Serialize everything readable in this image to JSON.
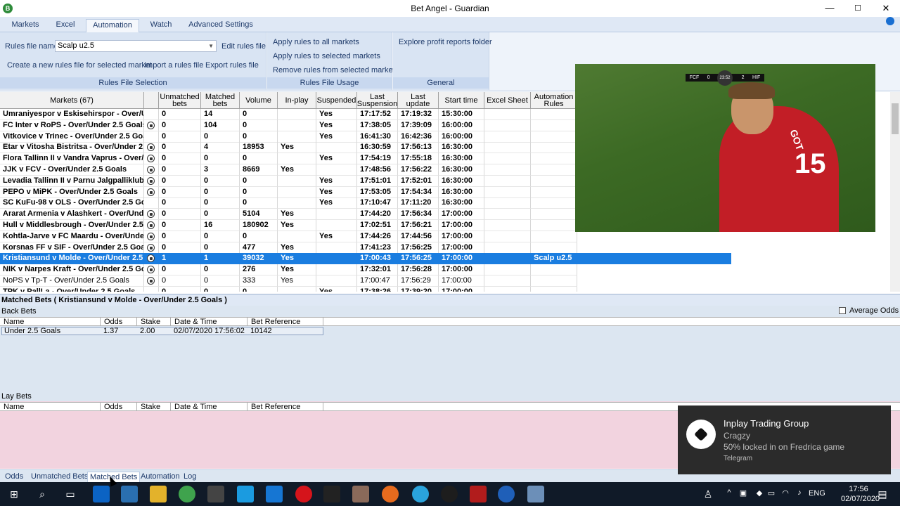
{
  "window": {
    "title": "Bet Angel - Guardian",
    "icon": "bet-angel-logo-icon",
    "minimize": "—",
    "maximize": "☐",
    "close": "✕"
  },
  "ribbon": {
    "tabs": [
      "Markets",
      "Excel",
      "Automation",
      "Watch",
      "Advanced Settings"
    ],
    "active_tab": "Automation",
    "rules_file": {
      "label": "Rules file name",
      "value": "Scalp u2.5",
      "edit": "Edit rules file",
      "create": "Create a new rules file for selected market",
      "import": "Import a rules file",
      "export": "Export rules file",
      "group_label": "Rules File Selection"
    },
    "usage": {
      "apply_all": "Apply rules to all markets",
      "apply_selected": "Apply rules to selected markets",
      "remove": "Remove rules from selected markets",
      "group_label": "Rules File Usage"
    },
    "general": {
      "explore": "Explore profit reports folder",
      "group_label": "General"
    }
  },
  "grid": {
    "headers": [
      "Markets (67)",
      "",
      "Unmatched bets",
      "Matched bets",
      "Volume",
      "In-play",
      "Suspended",
      "Last Suspension",
      "Last update",
      "Start time",
      "Excel Sheet",
      "Automation Rules"
    ],
    "rows": [
      {
        "name": "Umraniyespor v Eskisehirspor - Over/Under 2",
        "ball": false,
        "unmatched": "0",
        "matched": "14",
        "volume": "0",
        "inplay": "",
        "suspended": "Yes",
        "last_susp": "17:17:52",
        "last_update": "17:19:32",
        "start": "15:30:00",
        "excel": "",
        "rules": "",
        "bold": true
      },
      {
        "name": "FC Inter v RoPS - Over/Under 2.5 Goals",
        "ball": true,
        "unmatched": "0",
        "matched": "104",
        "volume": "0",
        "inplay": "",
        "suspended": "Yes",
        "last_susp": "17:38:05",
        "last_update": "17:39:09",
        "start": "16:00:00",
        "excel": "",
        "rules": "",
        "bold": true
      },
      {
        "name": "Vitkovice v Trinec - Over/Under 2.5 Goals",
        "ball": false,
        "unmatched": "0",
        "matched": "0",
        "volume": "0",
        "inplay": "",
        "suspended": "Yes",
        "last_susp": "16:41:30",
        "last_update": "16:42:36",
        "start": "16:00:00",
        "excel": "",
        "rules": "",
        "bold": true
      },
      {
        "name": "Etar v Vitosha Bistritsa - Over/Under 2.5 Goal",
        "ball": true,
        "unmatched": "0",
        "matched": "4",
        "volume": "18953",
        "inplay": "Yes",
        "suspended": "",
        "last_susp": "16:30:59",
        "last_update": "17:56:13",
        "start": "16:30:00",
        "excel": "",
        "rules": "",
        "bold": true
      },
      {
        "name": "Flora Tallinn II v Vandra Vaprus - Over/Under",
        "ball": true,
        "unmatched": "0",
        "matched": "0",
        "volume": "0",
        "inplay": "",
        "suspended": "Yes",
        "last_susp": "17:54:19",
        "last_update": "17:55:18",
        "start": "16:30:00",
        "excel": "",
        "rules": "",
        "bold": true
      },
      {
        "name": "JJK v FCV - Over/Under 2.5 Goals",
        "ball": true,
        "unmatched": "0",
        "matched": "3",
        "volume": "8669",
        "inplay": "Yes",
        "suspended": "",
        "last_susp": "17:48:56",
        "last_update": "17:56:22",
        "start": "16:30:00",
        "excel": "",
        "rules": "",
        "bold": true
      },
      {
        "name": "Levadia Tallinn II v Parnu Jalgpalliklubi - Ove",
        "ball": true,
        "unmatched": "0",
        "matched": "0",
        "volume": "0",
        "inplay": "",
        "suspended": "Yes",
        "last_susp": "17:51:01",
        "last_update": "17:52:01",
        "start": "16:30:00",
        "excel": "",
        "rules": "",
        "bold": true
      },
      {
        "name": "PEPO v MiPK - Over/Under 2.5 Goals",
        "ball": true,
        "unmatched": "0",
        "matched": "0",
        "volume": "0",
        "inplay": "",
        "suspended": "Yes",
        "last_susp": "17:53:05",
        "last_update": "17:54:34",
        "start": "16:30:00",
        "excel": "",
        "rules": "",
        "bold": true
      },
      {
        "name": "SC KuFu-98 v OLS - Over/Under 2.5 Goals",
        "ball": false,
        "unmatched": "0",
        "matched": "0",
        "volume": "0",
        "inplay": "",
        "suspended": "Yes",
        "last_susp": "17:10:47",
        "last_update": "17:11:20",
        "start": "16:30:00",
        "excel": "",
        "rules": "",
        "bold": true
      },
      {
        "name": "Ararat Armenia v Alashkert - Over/Under 2.5",
        "ball": true,
        "unmatched": "0",
        "matched": "0",
        "volume": "5104",
        "inplay": "Yes",
        "suspended": "",
        "last_susp": "17:44:20",
        "last_update": "17:56:34",
        "start": "17:00:00",
        "excel": "",
        "rules": "",
        "bold": true
      },
      {
        "name": "Hull v Middlesbrough - Over/Under 2.5 Goals",
        "ball": true,
        "unmatched": "0",
        "matched": "16",
        "volume": "180902",
        "inplay": "Yes",
        "suspended": "",
        "last_susp": "17:02:51",
        "last_update": "17:56:21",
        "start": "17:00:00",
        "excel": "",
        "rules": "",
        "bold": true
      },
      {
        "name": "Kohtla-Jarve v FC Maardu - Over/Under 2.5",
        "ball": true,
        "unmatched": "0",
        "matched": "0",
        "volume": "0",
        "inplay": "",
        "suspended": "Yes",
        "last_susp": "17:44:26",
        "last_update": "17:44:56",
        "start": "17:00:00",
        "excel": "",
        "rules": "",
        "bold": true
      },
      {
        "name": "Korsnas FF v SIF - Over/Under 2.5 Goals",
        "ball": true,
        "unmatched": "0",
        "matched": "0",
        "volume": "477",
        "inplay": "Yes",
        "suspended": "",
        "last_susp": "17:41:23",
        "last_update": "17:56:25",
        "start": "17:00:00",
        "excel": "",
        "rules": "",
        "bold": true
      },
      {
        "name": "Kristiansund v Molde - Over/Under 2.5 Goals",
        "ball": true,
        "unmatched": "1",
        "matched": "1",
        "volume": "39032",
        "inplay": "Yes",
        "suspended": "",
        "last_susp": "17:00:43",
        "last_update": "17:56:25",
        "start": "17:00:00",
        "excel": "",
        "rules": "Scalp u2.5",
        "bold": true,
        "selected": true
      },
      {
        "name": "NIK v Narpes Kraft - Over/Under 2.5 Goals",
        "ball": true,
        "unmatched": "0",
        "matched": "0",
        "volume": "276",
        "inplay": "Yes",
        "suspended": "",
        "last_susp": "17:32:01",
        "last_update": "17:56:28",
        "start": "17:00:00",
        "excel": "",
        "rules": "",
        "bold": true
      },
      {
        "name": "NoPS v Tp-T - Over/Under 2.5 Goals",
        "ball": true,
        "unmatched": "0",
        "matched": "0",
        "volume": "333",
        "inplay": "Yes",
        "suspended": "",
        "last_susp": "17:00:47",
        "last_update": "17:56:29",
        "start": "17:00:00",
        "excel": "",
        "rules": "",
        "bold": false
      },
      {
        "name": "TPK v PallLa - Over/Under 2.5 Goals",
        "ball": false,
        "unmatched": "0",
        "matched": "0",
        "volume": "0",
        "inplay": "",
        "suspended": "Yes",
        "last_susp": "17:38:26",
        "last_update": "17:39:20",
        "start": "17:00:00",
        "excel": "",
        "rules": "",
        "bold": true
      }
    ]
  },
  "video": {
    "home": "FCF",
    "home_score": "0",
    "clock": "23:52",
    "away_score": "2",
    "away": "HIF",
    "shirt_text": "GOT",
    "shirt_number": "15"
  },
  "matched_bets": {
    "title": "Matched Bets ( Kristiansund v Molde - Over/Under 2.5 Goals )",
    "back_label": "Back Bets",
    "average_odds": "Average Odds",
    "columns": [
      "Name",
      "Odds",
      "Stake",
      "Date & Time",
      "Bet Reference"
    ],
    "back_row": {
      "name": "Under 2.5 Goals",
      "odds": "1.37",
      "stake": "2.00",
      "datetime": "02/07/2020 17:56:02",
      "ref": "10142"
    },
    "lay_label": "Lay Bets"
  },
  "bottom_tabs": [
    "Odds",
    "Unmatched Bets",
    "Matched Bets",
    "Automation",
    "Log"
  ],
  "toast": {
    "title": "Inplay Trading Group",
    "sender": "Cragzy",
    "message": "50% locked in on Fredrica game",
    "app": "Telegram"
  },
  "taskbar": {
    "lang": "ENG",
    "time": "17:56",
    "date": "02/07/2020"
  }
}
